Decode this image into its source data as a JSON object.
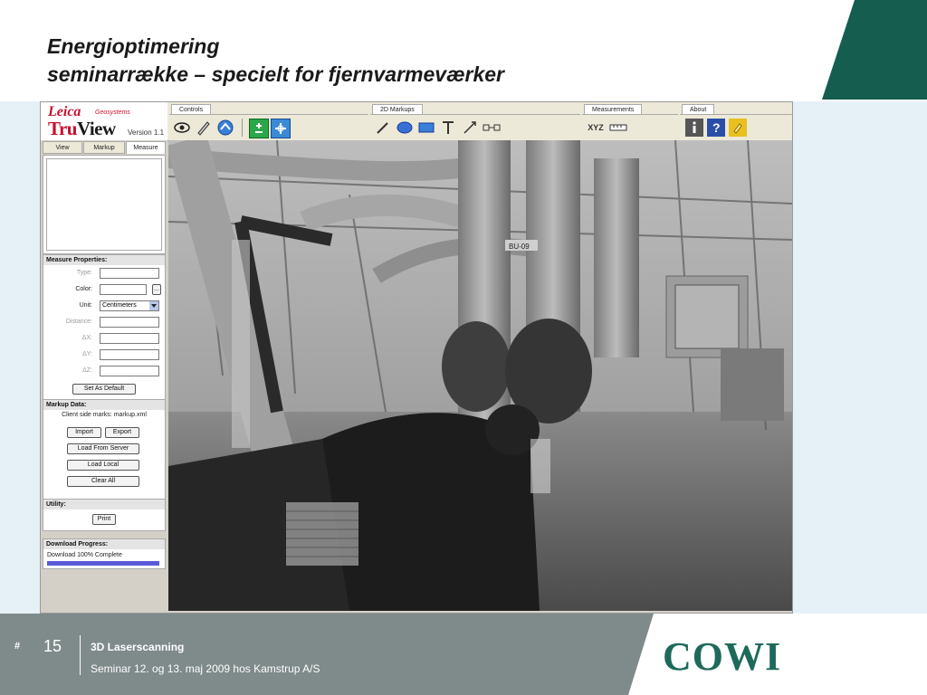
{
  "slide": {
    "title_line1": "Energioptimering",
    "title_line2": "seminarrække – specielt for fjernvarmeværker"
  },
  "app": {
    "brand_leica": "Leica",
    "brand_geosystems": "Geosystems",
    "brand_tru": "Tru",
    "brand_view": "View",
    "version": "Version 1.1",
    "toolbar_groups": [
      "Controls",
      "2D Markups",
      "Measurements",
      "About"
    ],
    "measurement_xyz": "XYZ",
    "side_tabs": [
      "View",
      "Markup",
      "Measure"
    ],
    "active_tab": "Measure",
    "measure_properties": {
      "title": "Measure Properties:",
      "type_label": "Type:",
      "color_label": "Color:",
      "color_button": "...",
      "unit_label": "Unit:",
      "unit_value": "Centimeters",
      "distance_label": "Distance:",
      "dx_label": "ΔX:",
      "dy_label": "ΔY:",
      "dz_label": "ΔZ:",
      "set_default": "Set As Default"
    },
    "markup_data": {
      "title": "Markup Data:",
      "marks_text": "Client side marks: markup.xml",
      "import": "Import",
      "export": "Export",
      "load_server": "Load From Server",
      "load_local": "Load Local",
      "clear_all": "Clear All"
    },
    "utility": {
      "title": "Utility:",
      "print": "Print"
    },
    "download": {
      "title": "Download Progress:",
      "status": "Download 100% Complete",
      "progress": 1.0
    },
    "viewport_text": "BU-09"
  },
  "footer": {
    "hash": "#",
    "page": "15",
    "line1": "3D Laserscanning",
    "line2": "Seminar 12. og 13. maj 2009 hos Kamstrup A/S",
    "logo": "COWI"
  },
  "colors": {
    "brand_green": "#1e6a5a",
    "footer_gray": "#7f8a8a",
    "accent_red": "#c8102e",
    "progress_blue": "#5a5ad8"
  }
}
